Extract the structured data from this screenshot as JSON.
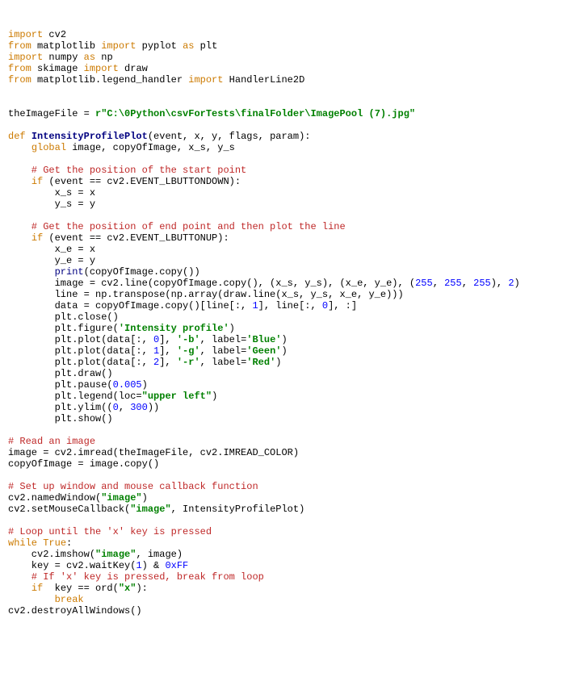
{
  "l1a": "import",
  "l1b": " cv2",
  "l2a": "from",
  "l2b": " matplotlib ",
  "l2c": "import",
  "l2d": " pyplot ",
  "l2e": "as",
  "l2f": " plt",
  "l3a": "import",
  "l3b": " numpy ",
  "l3c": "as",
  "l3d": " np",
  "l4a": "from",
  "l4b": " skimage ",
  "l4c": "import",
  "l4d": " draw",
  "l5a": "from",
  "l5b": " matplotlib.legend_handler ",
  "l5c": "import",
  "l5d": " HandlerLine2D",
  "blank": "",
  "l8a": "theImageFile = ",
  "l8b": "r\"C:\\0Python\\csvForTests\\finalFolder\\ImagePool (7).jpg\"",
  "l10a": "def ",
  "l10b": "IntensityProfilePlot",
  "l10c": "(event, x, y, flags, param):",
  "l11a": "    ",
  "l11b": "global",
  "l11c": " image, copyOfImage, x_s, y_s",
  "l13": "    # Get the position of the start point",
  "l14a": "    ",
  "l14b": "if",
  "l14c": " (event == cv2.EVENT_LBUTTONDOWN):",
  "l15": "        x_s = x",
  "l16": "        y_s = y",
  "l18": "    # Get the position of end point and then plot the line",
  "l19a": "    ",
  "l19b": "if",
  "l19c": " (event == cv2.EVENT_LBUTTONUP):",
  "l20": "        x_e = x",
  "l21": "        y_e = y",
  "l22a": "        ",
  "l22b": "print",
  "l22c": "(copyOfImage.copy())",
  "l23a": "        image = cv2.line(copyOfImage.copy(), (x_s, y_s), (x_e, y_e), (",
  "l23b": "255",
  "l23c": ", ",
  "l23d": "255",
  "l23e": ", ",
  "l23f": "255",
  "l23g": "), ",
  "l23h": "2",
  "l23i": ")",
  "l24": "        line = np.transpose(np.array(draw.line(x_s, y_s, x_e, y_e)))",
  "l25a": "        data = copyOfImage.copy()[line[:, ",
  "l25b": "1",
  "l25c": "], line[:, ",
  "l25d": "0",
  "l25e": "], :]",
  "l26": "        plt.close()",
  "l27a": "        plt.figure(",
  "l27b": "'Intensity profile'",
  "l27c": ")",
  "l28a": "        plt.plot(data[:, ",
  "l28b": "0",
  "l28c": "], ",
  "l28d": "'-b'",
  "l28e": ", label=",
  "l28f": "'Blue'",
  "l28g": ")",
  "l29a": "        plt.plot(data[:, ",
  "l29b": "1",
  "l29c": "], ",
  "l29d": "'-g'",
  "l29e": ", label=",
  "l29f": "'Geen'",
  "l29g": ")",
  "l30a": "        plt.plot(data[:, ",
  "l30b": "2",
  "l30c": "], ",
  "l30d": "'-r'",
  "l30e": ", label=",
  "l30f": "'Red'",
  "l30g": ")",
  "l31": "        plt.draw()",
  "l32a": "        plt.pause(",
  "l32b": "0.005",
  "l32c": ")",
  "l33a": "        plt.legend(loc=",
  "l33b": "\"upper left\"",
  "l33c": ")",
  "l34a": "        plt.ylim((",
  "l34b": "0",
  "l34c": ", ",
  "l34d": "300",
  "l34e": "))",
  "l35": "        plt.show()",
  "l37": "# Read an image",
  "l38": "image = cv2.imread(theImageFile, cv2.IMREAD_COLOR)",
  "l39": "copyOfImage = image.copy()",
  "l41": "# Set up window and mouse callback function",
  "l42a": "cv2.namedWindow(",
  "l42b": "\"image\"",
  "l42c": ")",
  "l43a": "cv2.setMouseCallback(",
  "l43b": "\"image\"",
  "l43c": ", IntensityProfilePlot)",
  "l45": "# Loop until the 'x' key is pressed",
  "l46a": "while ",
  "l46b": "True",
  "l46c": ":",
  "l47a": "    cv2.imshow(",
  "l47b": "\"image\"",
  "l47c": ", image)",
  "l48a": "    key = cv2.waitKey(",
  "l48b": "1",
  "l48c": ") & ",
  "l48d": "0xFF",
  "l49": "    # If 'x' key is pressed, break from loop",
  "l50a": "    ",
  "l50b": "if",
  "l50c": "  key == ord(",
  "l50d": "\"x\"",
  "l50e": "):",
  "l51a": "        ",
  "l51b": "break",
  "l52": "cv2.destroyAllWindows()"
}
